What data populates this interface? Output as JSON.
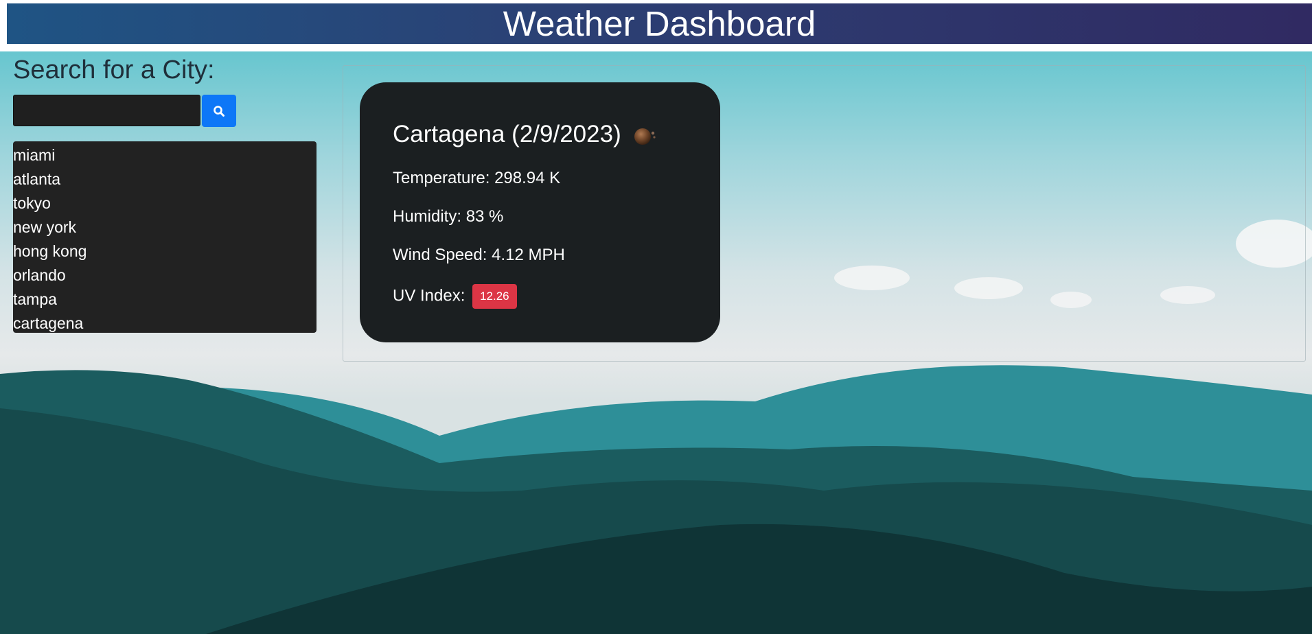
{
  "header": {
    "title": "Weather Dashboard"
  },
  "search": {
    "title": "Search for a City:",
    "input_value": "",
    "placeholder": "",
    "button_icon": "search-icon",
    "button_color": "#0d77f7"
  },
  "history": {
    "items": [
      "miami",
      "atlanta",
      "tokyo",
      "new york",
      "hong kong",
      "orlando",
      "tampa",
      "cartagena"
    ]
  },
  "current": {
    "title": "Cartagena (2/9/2023)",
    "icon": "weather-icon",
    "temperature": "Temperature: 298.94 K",
    "humidity": "Humidity: 83 %",
    "wind": "Wind Speed: 4.12 MPH",
    "uv_label": "UV Index:",
    "uv_value": "12.26",
    "uv_color": "#dc3545"
  }
}
